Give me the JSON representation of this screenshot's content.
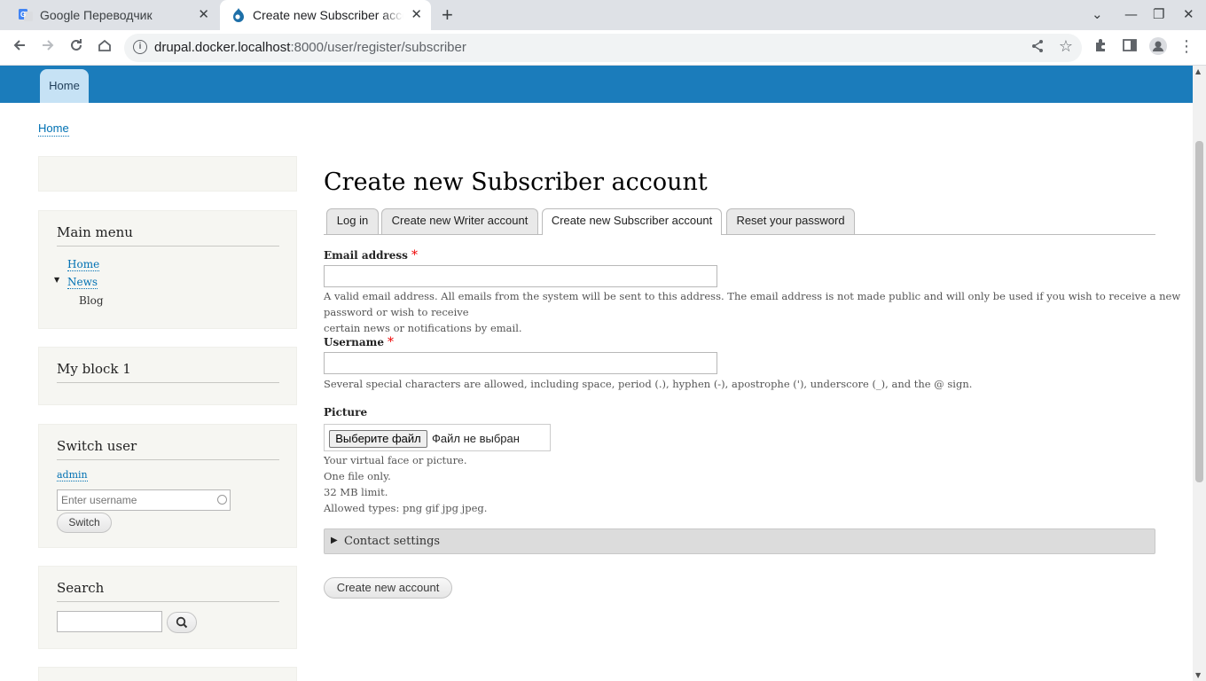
{
  "browser": {
    "tabs": [
      {
        "title": "Google Переводчик",
        "close": "✕"
      },
      {
        "title": "Create new Subscriber account",
        "close": "✕"
      }
    ],
    "new_tab": "+",
    "url_host": "drupal.docker.localhost",
    "url_rest": ":8000/user/register/subscriber",
    "controls": {
      "tab_search": "⌄",
      "minimize": "—",
      "restore": "❐",
      "close": "✕"
    }
  },
  "site": {
    "nav": {
      "home": "Home"
    },
    "breadcrumb": "Home"
  },
  "sidebar": {
    "main_menu": {
      "title": "Main menu",
      "items": [
        {
          "label": "Home"
        },
        {
          "label": "News"
        },
        {
          "label": "Blog"
        }
      ]
    },
    "my_block": {
      "title": "My block 1"
    },
    "switch_user": {
      "title": "Switch user",
      "user_link": "admin",
      "placeholder": "Enter username",
      "button": "Switch"
    },
    "search": {
      "title": "Search"
    }
  },
  "main": {
    "title": "Create new Subscriber account",
    "tabs": [
      {
        "label": "Log in"
      },
      {
        "label": "Create new Writer account"
      },
      {
        "label": "Create new Subscriber account"
      },
      {
        "label": "Reset your password"
      }
    ],
    "email": {
      "label": "Email address",
      "required": "*",
      "value": "",
      "description_line1": "A valid email address. All emails from the system will be sent to this address. The email address is not made public and will only be used if you wish to receive a new password or wish to receive",
      "description_line2": "certain news or notifications by email."
    },
    "username": {
      "label": "Username",
      "required": "*",
      "value": "",
      "description": "Several special characters are allowed, including space, period (.), hyphen (-), apostrophe ('), underscore (_), and the @ sign."
    },
    "picture": {
      "label": "Picture",
      "button": "Выберите файл",
      "status": "Файл не выбран",
      "help": [
        "Your virtual face or picture.",
        "One file only.",
        "32 MB limit.",
        "Allowed types: png gif jpg jpeg."
      ]
    },
    "contact_settings": "Contact settings",
    "submit": "Create new account"
  }
}
